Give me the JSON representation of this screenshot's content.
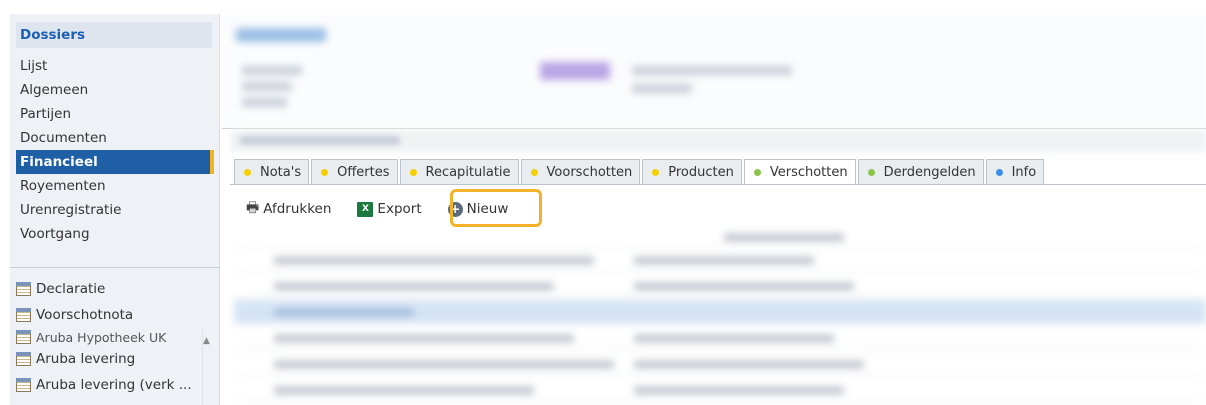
{
  "sidebar": {
    "header": "Dossiers",
    "items": [
      {
        "label": "Lijst"
      },
      {
        "label": "Algemeen"
      },
      {
        "label": "Partijen"
      },
      {
        "label": "Documenten"
      },
      {
        "label": "Financieel",
        "active": true
      },
      {
        "label": "Royementen"
      },
      {
        "label": "Urenregistratie"
      },
      {
        "label": "Voortgang"
      }
    ],
    "documents": [
      {
        "label": "Declaratie",
        "icon": "calendar-icon"
      },
      {
        "label": "Voorschotnota",
        "icon": "calendar-icon"
      },
      {
        "label": "Aruba Hypotheek UK",
        "icon": "calendar-icon"
      },
      {
        "label": "Aruba levering",
        "icon": "calendar-icon"
      },
      {
        "label": "Aruba levering (verk ...",
        "icon": "calendar-icon"
      }
    ]
  },
  "tabs": [
    {
      "label": "Nota's",
      "dot_color": "#f5d000"
    },
    {
      "label": "Offertes",
      "dot_color": "#f5d000"
    },
    {
      "label": "Recapitulatie",
      "dot_color": "#f5d000"
    },
    {
      "label": "Voorschotten",
      "dot_color": "#f5d000"
    },
    {
      "label": "Producten",
      "dot_color": "#f5d000"
    },
    {
      "label": "Verschotten",
      "dot_color": "#8bc34a",
      "active": true
    },
    {
      "label": "Derdengelden",
      "dot_color": "#8bc34a"
    },
    {
      "label": "Info",
      "dot_color": "#3a8ee6"
    }
  ],
  "toolbar": {
    "print_label": "Afdrukken",
    "export_label": "Export",
    "new_label": "Nieuw"
  },
  "colors": {
    "active_nav": "#1e5fa6",
    "highlight": "#f2b22a"
  }
}
